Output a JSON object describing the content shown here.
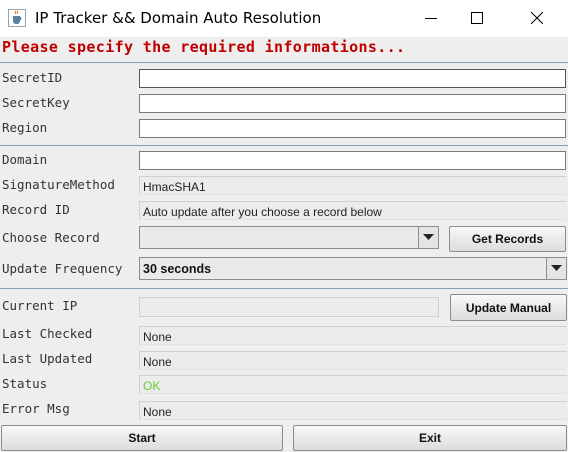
{
  "window": {
    "title": "IP Tracker && Domain Auto Resolution"
  },
  "heading": "Please specify the required informations...",
  "credentials": {
    "secret_id_label": "SecretID",
    "secret_id_value": "",
    "secret_key_label": "SecretKey",
    "secret_key_value": "",
    "region_label": "Region",
    "region_value": ""
  },
  "domain_section": {
    "domain_label": "Domain",
    "domain_value": "",
    "signature_label": "SignatureMethod",
    "signature_value": "HmacSHA1",
    "record_id_label": "Record ID",
    "record_id_value": "Auto update after you choose a record below",
    "choose_record_label": "Choose Record",
    "choose_record_value": "",
    "get_records_button": "Get Records",
    "update_frequency_label": "Update Frequency",
    "update_frequency_value": "30 seconds"
  },
  "status_section": {
    "current_ip_label": "Current IP",
    "current_ip_value": "",
    "update_manual_button": "Update Manual",
    "last_checked_label": "Last Checked",
    "last_checked_value": "None",
    "last_updated_label": "Last Updated",
    "last_updated_value": "None",
    "status_label": "Status",
    "status_value": "OK",
    "error_msg_label": "Error Msg",
    "error_msg_value": "None"
  },
  "actions": {
    "start_button": "Start",
    "exit_button": "Exit"
  },
  "colors": {
    "heading": "#c00000",
    "status_ok": "#66cc33",
    "divider": "#8a9cb8"
  },
  "icons": {
    "app": "java-cup-icon",
    "minimize": "minimize-icon",
    "maximize": "maximize-icon",
    "close": "close-icon",
    "dropdown": "chevron-down-icon"
  }
}
